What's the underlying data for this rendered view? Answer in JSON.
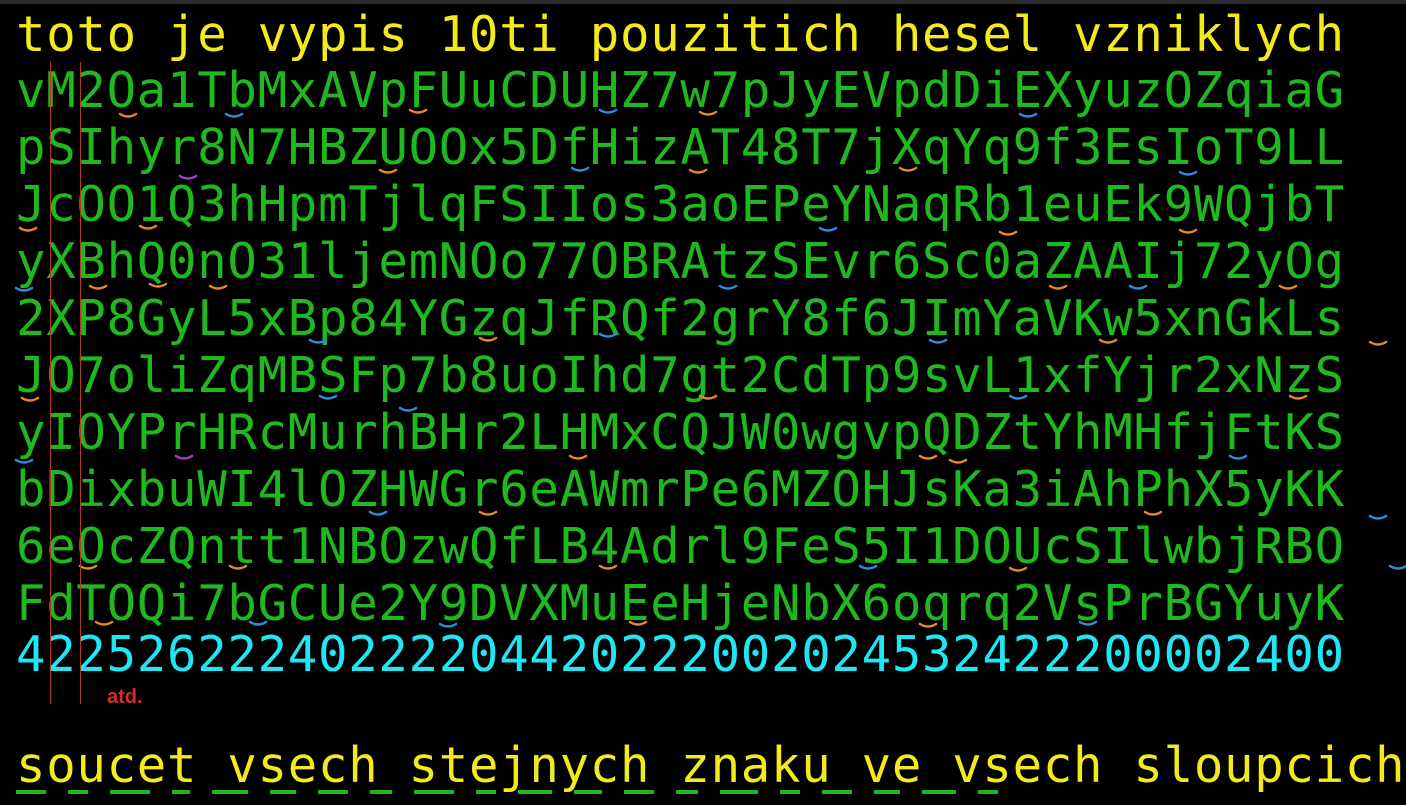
{
  "header": {
    "text": "toto je vypis 10ti pouzitich hesel vzniklych"
  },
  "passwords": [
    "vM2Oa1TbMxAVpFUuCDUHZ7w7pJyEVpdDiEXyuzOZqiaG",
    "pSIhyr8N7HBZUOOx5DfHizAT48T7jXqYq9f3EsIoT9LL",
    "JcOO1Q3hHpmTjlqFSIIos3aoEPeYNaqRb1euEk9WQjbT",
    "yXBhQ0nO31ljemNOo77OBRAtzSEvr6Sc0aZAAIj72yOg",
    "2XP8GyL5xBp84YGzqJfRQf2grY8f6JImYaVKw5xnGkLs",
    "JO7oliZqMBSFp7b8uoIhd7gt2CdTp9svL1xfYjr2xNzS",
    "yIOYPrHRcMurhBHr2LHMxCQJW0wgvpQDZtYhMHfjFtKS",
    "bDixbuWI4lOZHWGr6eAWmrPe6MZOHJsKa3iAhPhX5yKK",
    "6eOcZQntt1NBOzwQfLB4Adrl9FeS5I1DOUcSIlwbjRBO",
    "FdTOQi7bGCUe2Y9DVXMuEeHjeNbX6oqrq2VsPrBGYuyK"
  ],
  "counts": "42252622240222204420222002024532422200002400",
  "note": "atd.",
  "footer": {
    "text": "soucet vsech stejnych znaku ve vsech sloupcich"
  },
  "colors": {
    "background": "#000000",
    "header": "#f2ea1c",
    "passwords": "#1fb81f",
    "counts": "#1fe6f2",
    "guide": "#b03a20",
    "note": "#d82a2a"
  }
}
